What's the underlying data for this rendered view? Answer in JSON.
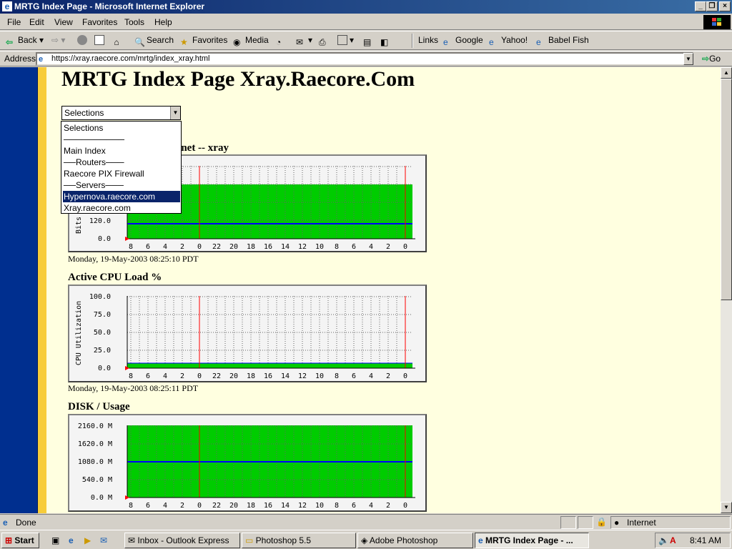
{
  "window": {
    "title": "MRTG Index Page - Microsoft Internet Explorer"
  },
  "menu": [
    "File",
    "Edit",
    "View",
    "Favorites",
    "Tools",
    "Help"
  ],
  "toolbar": {
    "back": "Back",
    "search": "Search",
    "favorites": "Favorites",
    "media": "Media",
    "links": "Links",
    "google": "Google",
    "yahoo": "Yahoo!",
    "babelfish": "Babel Fish"
  },
  "address": {
    "label": "Address",
    "url": "https://xray.raecore.com/mrtg/index_xray.html",
    "go": "Go"
  },
  "page": {
    "title": "MRTG Index Page Xray.Raecore.Com",
    "select_value": "Selections",
    "dropdown": [
      "Selections",
      "──────────",
      "Main Index",
      "──Routers───",
      "Raecore PIX Firewall",
      "──Servers───",
      "Hypernova.raecore.com",
      "Xray.raecore.com"
    ],
    "selected_index": 6,
    "graph1": {
      "title_visible": "ernet -- xray",
      "timestamp": "Monday, 19-May-2003 08:25:10 PDT",
      "ylabel": "Bits",
      "yticks": [
        "120.0",
        "0.0"
      ]
    },
    "graph2": {
      "title": "Active CPU Load %",
      "timestamp": "Monday, 19-May-2003 08:25:11 PDT",
      "ylabel": "CPU Utilization",
      "yticks": [
        "100.0",
        "75.0",
        "50.0",
        "25.0",
        "0.0"
      ]
    },
    "graph3": {
      "title": "DISK / Usage",
      "yticks": [
        "2160.0 M",
        "1620.0 M",
        "1080.0 M",
        "540.0 M",
        "0.0 M"
      ]
    },
    "xticks": [
      "8",
      "6",
      "4",
      "2",
      "0",
      "22",
      "20",
      "18",
      "16",
      "14",
      "12",
      "10",
      "8",
      "6",
      "4",
      "2",
      "0"
    ]
  },
  "status": {
    "text": "Done",
    "zone": "Internet"
  },
  "taskbar": {
    "start": "Start",
    "tasks": [
      "Inbox - Outlook Express",
      "Photoshop 5.5",
      "Adobe Photoshop",
      "MRTG Index Page - ..."
    ],
    "clock": "8:41 AM"
  },
  "colors": {
    "graph_fill": "#00cc00",
    "graph_line": "#0000ff",
    "content_bg": "#ffffe0",
    "left_strip": "#002f8f",
    "accent_strip": "#f7cc3a"
  }
}
